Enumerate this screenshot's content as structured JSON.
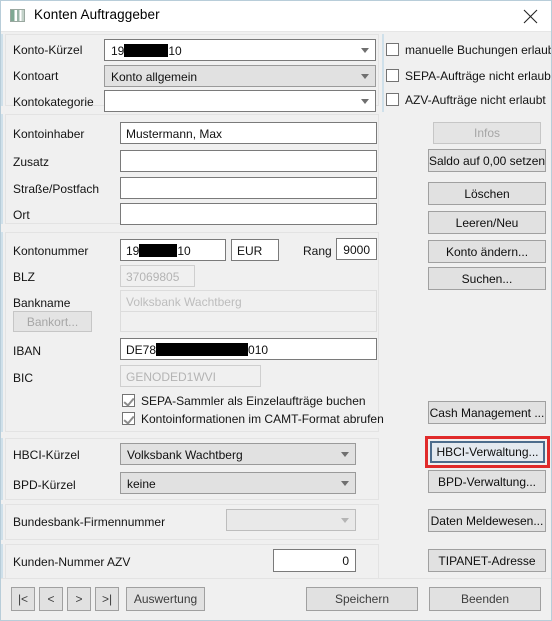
{
  "window": {
    "title": "Konten Auftraggeber",
    "icon": "account-book-icon",
    "close_label": "close-icon"
  },
  "account_header": {
    "fields": [
      {
        "label": "Konto-Kürzel",
        "value_prefix": "19",
        "value_suffix": "10",
        "redacted": true
      },
      {
        "label": "Kontoart",
        "value": "Konto allgemein"
      },
      {
        "label": "Kontokategorie",
        "value": ""
      }
    ],
    "checkboxes": [
      {
        "label": "manuelle Buchungen erlaubt",
        "checked": false
      },
      {
        "label": "SEPA-Aufträge nicht erlaubt",
        "checked": false
      },
      {
        "label": "AZV-Aufträge nicht erlaubt",
        "checked": false
      }
    ]
  },
  "holder": {
    "rows": [
      {
        "label": "Kontoinhaber",
        "value": "Mustermann, Max"
      },
      {
        "label": "Zusatz",
        "value": ""
      },
      {
        "label": "Straße/Postfach",
        "value": ""
      },
      {
        "label": "Ort",
        "value": ""
      }
    ]
  },
  "bank": {
    "kontonummer_label": "Kontonummer",
    "kontonummer_prefix": "19",
    "kontonummer_suffix": "10",
    "currency": "EUR",
    "rang_label": "Rang",
    "rang_value": "9000",
    "blz_label": "BLZ",
    "blz_value": "37069805",
    "bankname_label": "Bankname",
    "bankname_value": "Volksbank Wachtberg",
    "bankort_button": "Bankort...",
    "bankort_value": "",
    "iban_label": "IBAN",
    "iban_prefix": "DE78",
    "iban_suffix": "010",
    "bic_label": "BIC",
    "bic_value": "GENODED1WVI",
    "checkboxes": [
      {
        "label": "SEPA-Sammler als Einzelaufträge buchen",
        "checked": true
      },
      {
        "label": "Kontoinformationen im CAMT-Format abrufen",
        "checked": true
      }
    ]
  },
  "hbci": {
    "kuerzel_label": "HBCI-Kürzel",
    "kuerzel_value": "Volksbank Wachtberg",
    "bpd_label": "BPD-Kürzel",
    "bpd_value": "keine"
  },
  "bundesbank": {
    "label": "Bundesbank-Firmennummer",
    "value": ""
  },
  "kunden": {
    "label": "Kunden-Nummer AZV",
    "value": "0"
  },
  "side_buttons": [
    {
      "label": "Infos",
      "state": "disabled"
    },
    {
      "label": "Saldo auf 0,00 setzen",
      "state": "normal"
    },
    {
      "label": "Löschen",
      "state": "normal"
    },
    {
      "label": "Leeren/Neu",
      "state": "normal"
    },
    {
      "label": "Konto ändern...",
      "state": "normal"
    },
    {
      "label": "Suchen...",
      "state": "normal"
    },
    {
      "label": "Cash Management ...",
      "state": "normal"
    },
    {
      "label": "HBCI-Verwaltung...",
      "state": "focused",
      "highlight": "#e02a2a"
    },
    {
      "label": "BPD-Verwaltung...",
      "state": "normal"
    },
    {
      "label": "Daten Meldewesen...",
      "state": "normal"
    },
    {
      "label": "TIPANET-Adresse",
      "state": "normal"
    }
  ],
  "bottom_bar": {
    "nav": [
      {
        "label": "|<",
        "name": "first-record-button"
      },
      {
        "label": "<",
        "name": "previous-record-button"
      },
      {
        "label": ">",
        "name": "next-record-button"
      },
      {
        "label": ">|",
        "name": "last-record-button"
      }
    ],
    "auswertung": "Auswertung",
    "speichern": "Speichern",
    "beenden": "Beenden"
  }
}
